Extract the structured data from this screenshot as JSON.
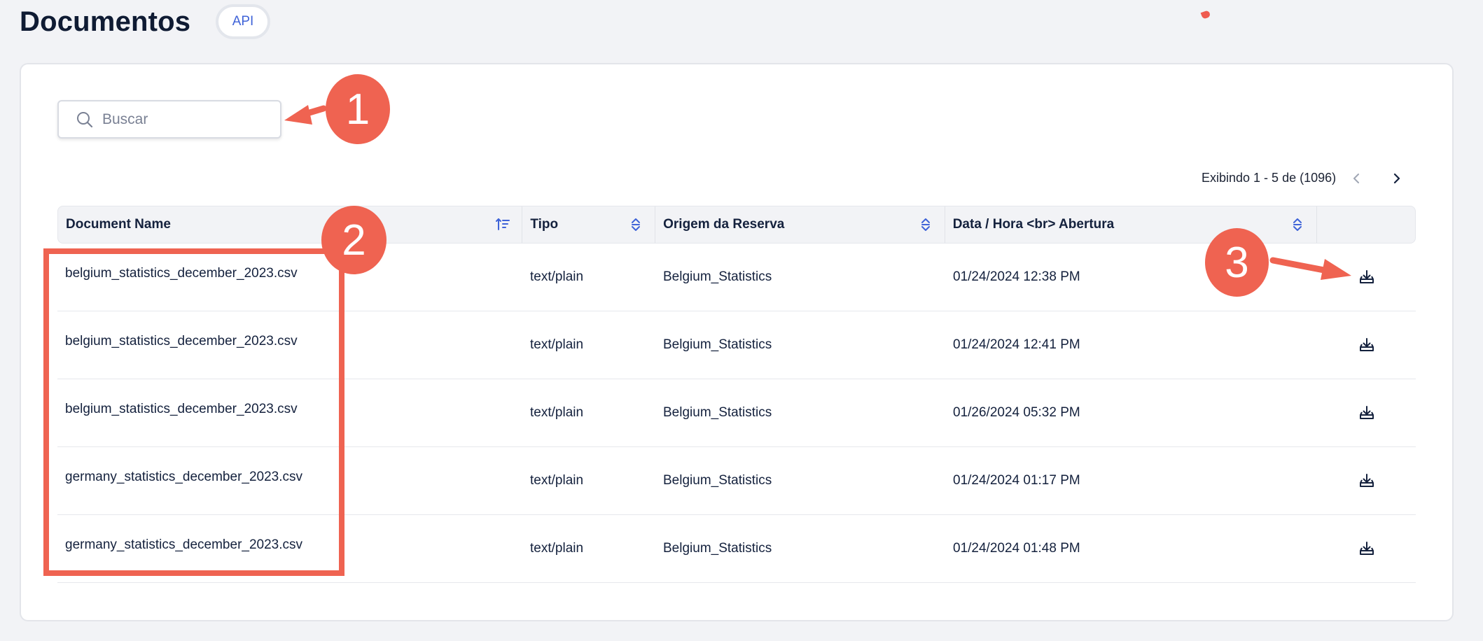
{
  "header": {
    "title": "Documentos",
    "badge": "API"
  },
  "search": {
    "placeholder": "Buscar",
    "value": ""
  },
  "pagination": {
    "text": "Exibindo 1 - 5 de (1096)"
  },
  "table": {
    "columns": [
      {
        "label": "Document Name"
      },
      {
        "label": "Tipo"
      },
      {
        "label": "Origem da Reserva"
      },
      {
        "label": "Data / Hora <br> Abertura"
      },
      {
        "label": ""
      }
    ],
    "rows": [
      {
        "name": "belgium_statistics_december_2023.csv",
        "tipo": "text/plain",
        "origem": "Belgium_Statistics",
        "data": "01/24/2024 12:38 PM"
      },
      {
        "name": "belgium_statistics_december_2023.csv",
        "tipo": "text/plain",
        "origem": "Belgium_Statistics",
        "data": "01/24/2024 12:41 PM"
      },
      {
        "name": "belgium_statistics_december_2023.csv",
        "tipo": "text/plain",
        "origem": "Belgium_Statistics",
        "data": "01/26/2024 05:32 PM"
      },
      {
        "name": "germany_statistics_december_2023.csv",
        "tipo": "text/plain",
        "origem": "Belgium_Statistics",
        "data": "01/24/2024 01:17 PM"
      },
      {
        "name": "germany_statistics_december_2023.csv",
        "tipo": "text/plain",
        "origem": "Belgium_Statistics",
        "data": "01/24/2024 01:48 PM"
      }
    ]
  },
  "annotations": {
    "marker_1": "1",
    "marker_2": "2",
    "marker_3": "3",
    "color": "#ef6351"
  },
  "icons": {
    "search": "search-icon",
    "prev": "chevron-left-icon",
    "next": "chevron-right-icon",
    "sort_active": "sort-descending-icon",
    "sort": "sort-icon",
    "download": "download-icon"
  },
  "colors": {
    "background": "#f2f3f6",
    "accent": "#3f63d8",
    "text": "#14213d"
  }
}
